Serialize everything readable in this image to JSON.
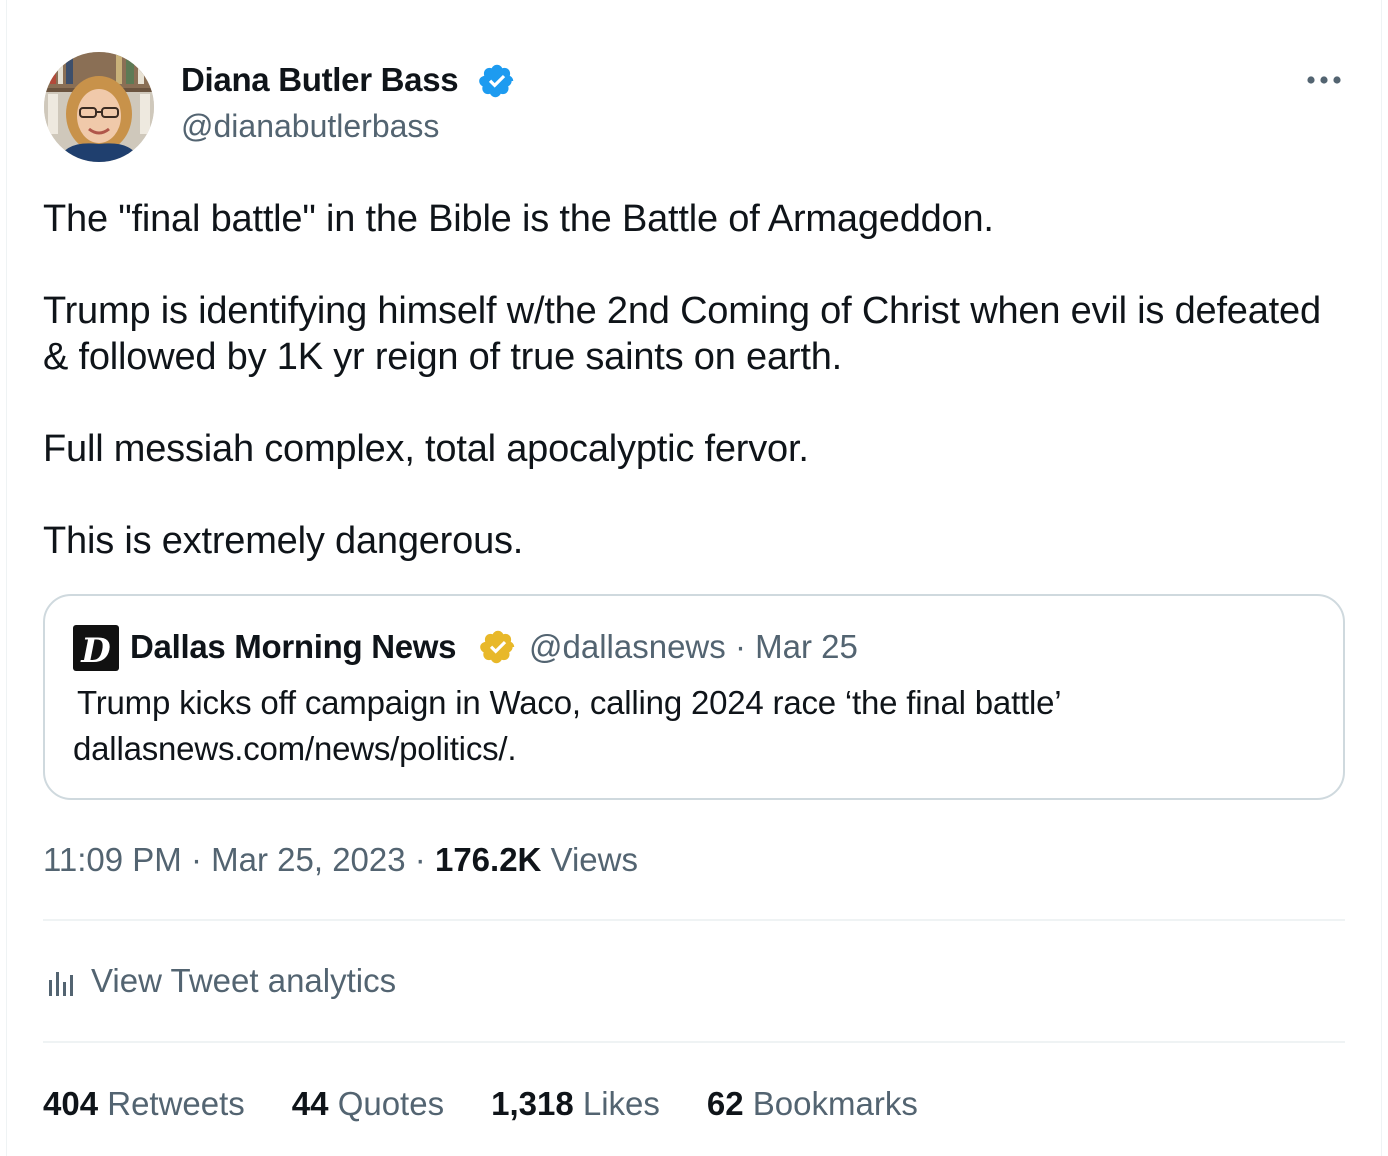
{
  "author": {
    "name": "Diana Butler Bass",
    "handle": "@dianabutlerbass",
    "verified_color": "#1d9bf0"
  },
  "tweet": {
    "paragraphs": [
      "The \"final battle\" in the Bible is the Battle of Armageddon.",
      "Trump is identifying himself w/the 2nd Coming of Christ when evil is defeated & followed by 1K yr reign of true saints on earth.",
      "Full messiah complex, total apocalyptic fervor.",
      "This is extremely dangerous."
    ]
  },
  "quoted": {
    "name": "Dallas Morning News",
    "handle": "@dallasnews",
    "separator": "·",
    "date": "Mar 25",
    "text_line1": "Trump kicks off campaign in Waco, calling 2024 race ‘the final battle’",
    "text_line2": "dallasnews.com/news/politics/.",
    "verified_color": "#e8b829"
  },
  "meta": {
    "time": "11:09 PM",
    "date": "Mar 25, 2023",
    "separator": "·",
    "views_count": "176.2K",
    "views_label": "Views"
  },
  "analytics": {
    "label": "View Tweet analytics",
    "icon": "bar-chart-icon"
  },
  "stats": [
    {
      "count": "404",
      "label": "Retweets"
    },
    {
      "count": "44",
      "label": "Quotes"
    },
    {
      "count": "1,318",
      "label": "Likes"
    },
    {
      "count": "62",
      "label": "Bookmarks"
    }
  ],
  "more_icon": "more-horizontal-icon"
}
